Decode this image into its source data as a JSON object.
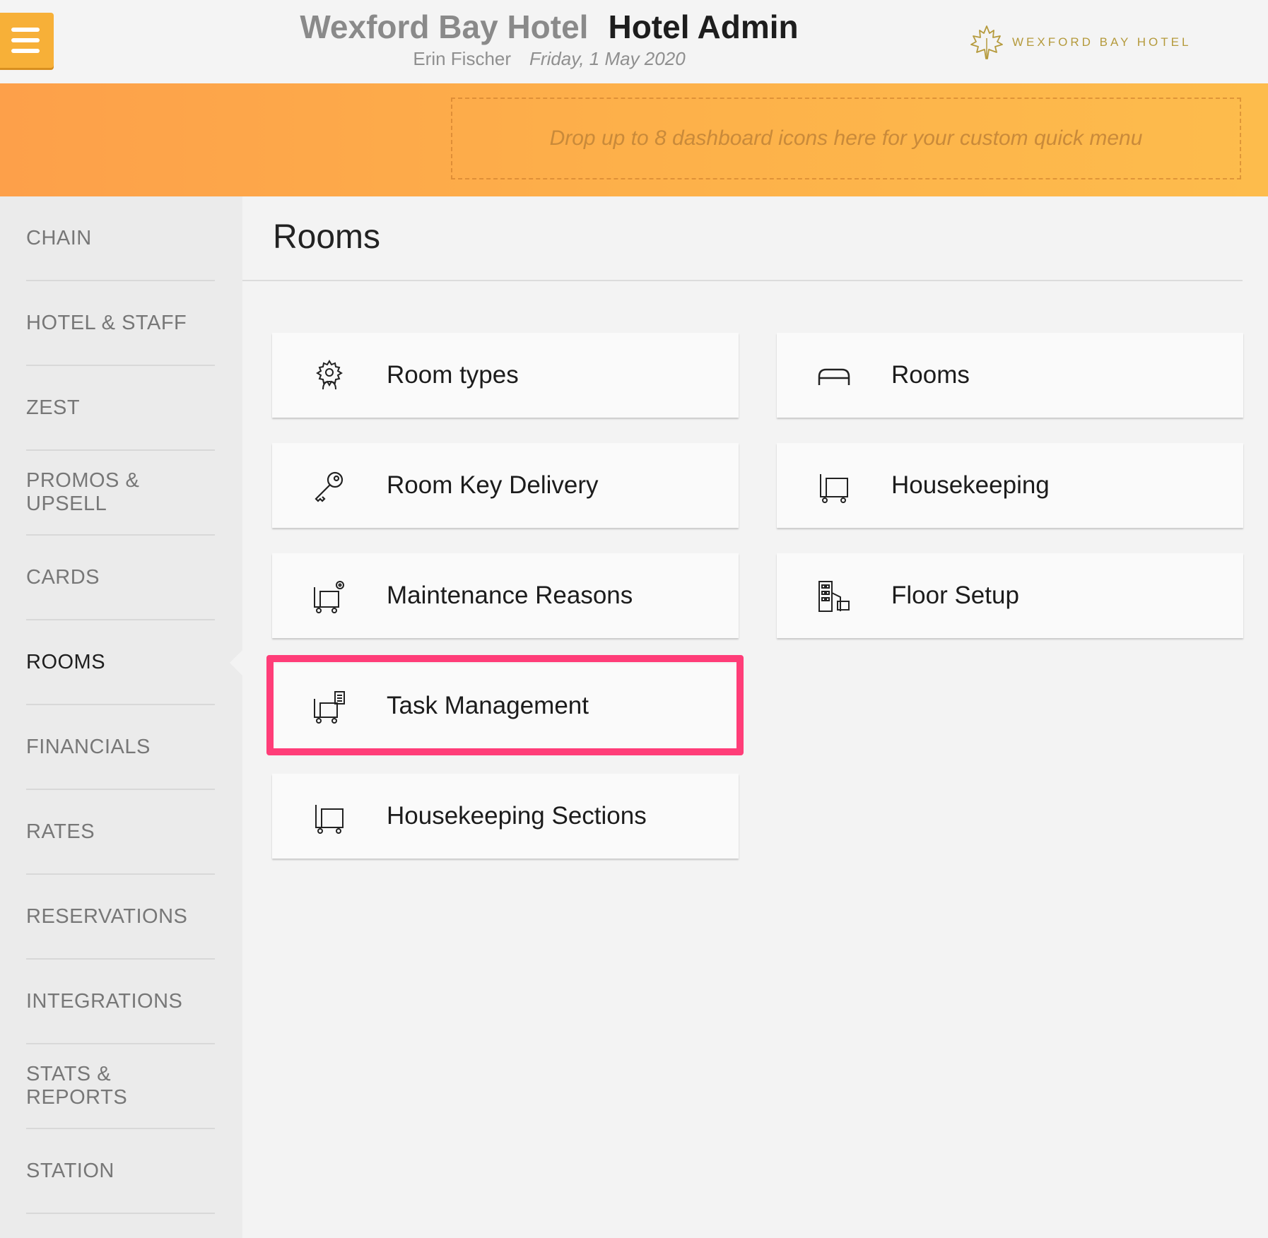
{
  "header": {
    "hotel_name": "Wexford Bay Hotel",
    "app_title": "Hotel Admin",
    "user_name": "Erin Fischer",
    "date": "Friday, 1 May 2020",
    "brand_text": "WEXFORD BAY HOTEL",
    "menu_icon": "hamburger-icon",
    "accent_color": "#f7b038"
  },
  "quick_menu": {
    "placeholder": "Drop up to 8 dashboard icons here for your custom quick menu"
  },
  "sidebar": {
    "items": [
      {
        "label": "CHAIN"
      },
      {
        "label": "HOTEL & STAFF"
      },
      {
        "label": "ZEST"
      },
      {
        "label": "PROMOS & UPSELL"
      },
      {
        "label": "CARDS"
      },
      {
        "label": "ROOMS",
        "active": true
      },
      {
        "label": "FINANCIALS"
      },
      {
        "label": "RATES"
      },
      {
        "label": "RESERVATIONS"
      },
      {
        "label": "INTEGRATIONS"
      },
      {
        "label": "STATS & REPORTS"
      },
      {
        "label": "STATION"
      }
    ]
  },
  "main": {
    "title": "Rooms",
    "tiles": [
      {
        "label": "Room types",
        "icon": "gear-person-icon"
      },
      {
        "label": "Rooms",
        "icon": "bed-icon"
      },
      {
        "label": "Room Key Delivery",
        "icon": "key-icon"
      },
      {
        "label": "Housekeeping",
        "icon": "cart-icon"
      },
      {
        "label": "Maintenance Reasons",
        "icon": "cart-gear-icon"
      },
      {
        "label": "Floor Setup",
        "icon": "building-icon"
      },
      {
        "label": "Task Management",
        "icon": "cart-clipboard-icon",
        "highlighted": true
      },
      {
        "label": "Housekeeping Sections",
        "icon": "cart-icon"
      }
    ],
    "highlight_color": "#ff3d78"
  }
}
